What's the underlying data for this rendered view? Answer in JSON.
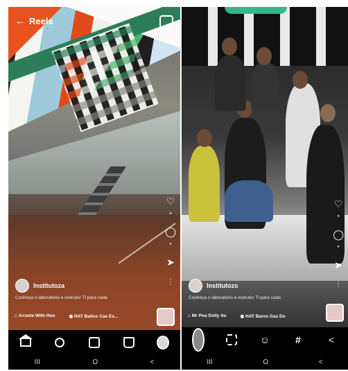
{
  "left_screen": {
    "header_title": "Reels",
    "username": "Institutoza",
    "caption": "Conheça o laboratório e instrutor TI para cada",
    "tags": [
      {
        "label": "Arraste With Hoo"
      },
      {
        "label": "HAT Baños Cas Es..."
      }
    ],
    "nav": [
      "home-icon",
      "search-icon",
      "reels-icon",
      "shop-icon",
      "profile-icon"
    ]
  },
  "right_screen": {
    "username": "Institutozo",
    "caption": "Conheça o laboratório e instrutor TI para cada",
    "tags": [
      {
        "label": "Mr Pou  Dolly Su"
      },
      {
        "label": "HAT Baros Gas Do"
      }
    ],
    "tools": [
      "crop-icon",
      "sticker-icon",
      "text-icon",
      "share-icon"
    ]
  },
  "system_nav": [
    "III",
    "O",
    "<"
  ]
}
